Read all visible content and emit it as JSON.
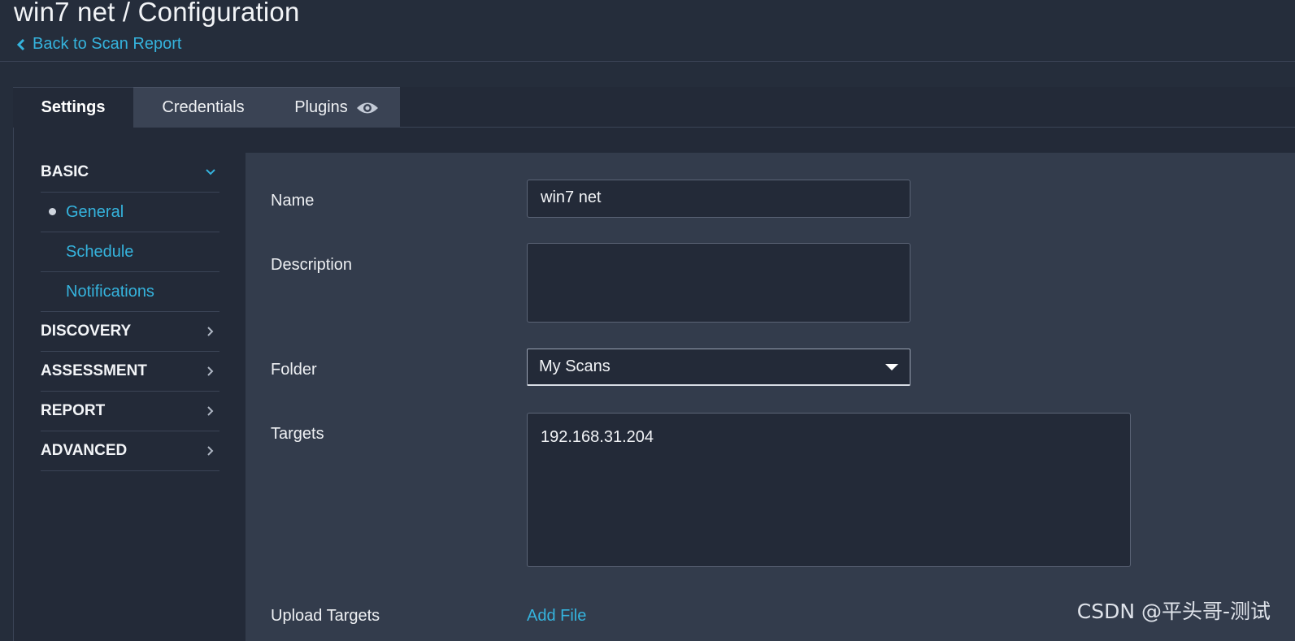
{
  "header": {
    "title": "win7 net / Configuration",
    "back_label": "Back to Scan Report"
  },
  "tabs": [
    {
      "label": "Settings",
      "active": true
    },
    {
      "label": "Credentials",
      "active": false
    },
    {
      "label": "Plugins",
      "active": false,
      "icon": "eye-icon"
    }
  ],
  "sidebar": {
    "sections": [
      {
        "label": "BASIC",
        "expanded": true,
        "items": [
          "General",
          "Schedule",
          "Notifications"
        ],
        "selected": "General"
      },
      {
        "label": "DISCOVERY",
        "expanded": false
      },
      {
        "label": "ASSESSMENT",
        "expanded": false
      },
      {
        "label": "REPORT",
        "expanded": false
      },
      {
        "label": "ADVANCED",
        "expanded": false
      }
    ]
  },
  "form": {
    "name_label": "Name",
    "name_value": "win7 net",
    "description_label": "Description",
    "description_value": "",
    "folder_label": "Folder",
    "folder_value": "My Scans",
    "targets_label": "Targets",
    "targets_value": "192.168.31.204",
    "upload_label": "Upload Targets",
    "add_file_label": "Add File"
  },
  "watermark": "CSDN @平头哥-测试",
  "colors": {
    "background": "#252d3b",
    "content_bg": "#333c4c",
    "accent": "#35b3dd",
    "input_bg": "#232a38"
  }
}
